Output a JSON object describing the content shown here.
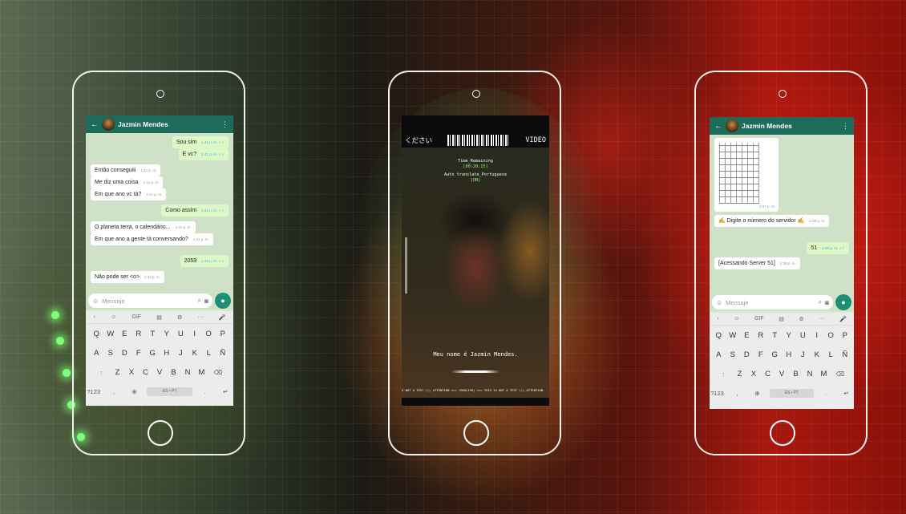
{
  "colors": {
    "wa_header": "#1d6b5a",
    "mic_button": "#1d8f78",
    "bubble_out": "#dcf8c6"
  },
  "phone_left": {
    "contact_name": "Jazmin Mendes",
    "messages": [
      {
        "text": "Sou sim",
        "time": "1:41 p. m.",
        "dir": "out"
      },
      {
        "text": "E vc?",
        "time": "1:41 p. m.",
        "dir": "out"
      },
      {
        "text": "Então conseguiii",
        "time": "1:41 p. m.",
        "dir": "in"
      },
      {
        "text": "Me diz uma coisa",
        "time": "1:41 p. m.",
        "dir": "in"
      },
      {
        "text": "Em que ano vc tá?",
        "time": "1:41 p. m.",
        "dir": "in"
      },
      {
        "text": "Como assim",
        "time": "1:41 p. m.",
        "dir": "out"
      },
      {
        "text": "O planeta terra, o calendário...",
        "time": "1:41 p. m.",
        "dir": "in"
      },
      {
        "text": "Em que ano a gente tá conversando?",
        "time": "1:41 p. m.",
        "dir": "in"
      },
      {
        "text": "2059",
        "time": "1:42 p. m.",
        "dir": "out"
      },
      {
        "text": "Não pode ser <o>",
        "time": "1:42 p. m.",
        "dir": "in"
      }
    ],
    "input_placeholder": "Mensaje",
    "keyboard": {
      "space_label": "ES • PT"
    }
  },
  "phone_center": {
    "top_left_text": "ください",
    "top_right_text": "VIDEO",
    "time_label": "Time_Remaining",
    "time_value": "[00:20:15]",
    "translate_label": "Auto translate_Portuguese",
    "translate_value": "[ON]",
    "caption": "Meu nome é Jazmin Mendes.",
    "ticker": "S NOT A TEST \\\\\\ ATTENTION >>> (ENGLISH) >>> THIS IS NOT A TEST \\\\\\ ATTENTION"
  },
  "phone_right": {
    "contact_name": "Jazmin Mendes",
    "messages": [
      {
        "text": "",
        "time": "2:37 p. m.",
        "dir": "in",
        "kind": "image"
      },
      {
        "text": "✍ Digite o número do servidor ✍",
        "time": "2:38 p. m.",
        "dir": "in"
      },
      {
        "text": "51",
        "time": "2:38 p. m.",
        "dir": "out"
      },
      {
        "text": "[Acessando Server 51]",
        "time": "2:38 p. m.",
        "dir": "in"
      }
    ],
    "input_placeholder": "Mensaje",
    "keyboard": {
      "space_label": "ES • PT"
    }
  },
  "keyboard_rows": {
    "row1": [
      "Q",
      "W",
      "E",
      "R",
      "T",
      "Y",
      "U",
      "I",
      "O",
      "P"
    ],
    "row2": [
      "A",
      "S",
      "D",
      "F",
      "G",
      "H",
      "J",
      "K",
      "L",
      "Ñ"
    ],
    "row3": [
      "Z",
      "X",
      "C",
      "V",
      "B",
      "N",
      "M"
    ],
    "num_key": "?123",
    "gif_label": "GIF"
  }
}
